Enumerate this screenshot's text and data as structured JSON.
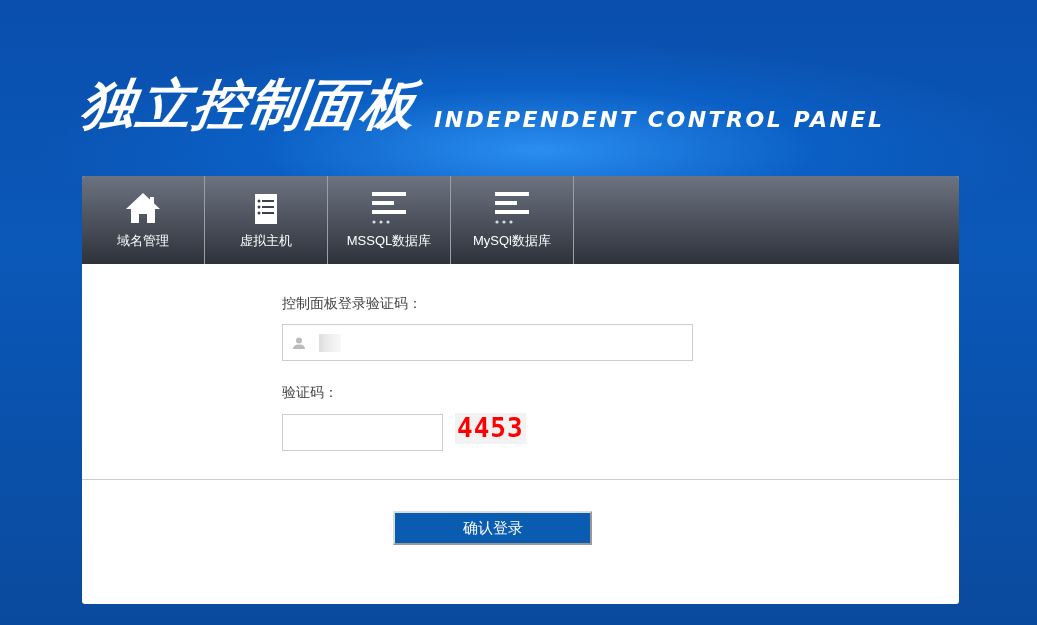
{
  "header": {
    "title": "独立控制面板",
    "subtitle": "INDEPENDENT CONTROL PANEL"
  },
  "tabs": [
    {
      "label": "域名管理",
      "kind": "home"
    },
    {
      "label": "虚拟主机",
      "kind": "list"
    },
    {
      "label": "MSSQL数据库",
      "kind": "lines"
    },
    {
      "label": "MySQl数据库",
      "kind": "lines"
    }
  ],
  "form": {
    "code_label": "控制面板登录验证码：",
    "captcha_label": "验证码：",
    "captcha": "4453"
  },
  "buttons": [
    "确认登录"
  ]
}
